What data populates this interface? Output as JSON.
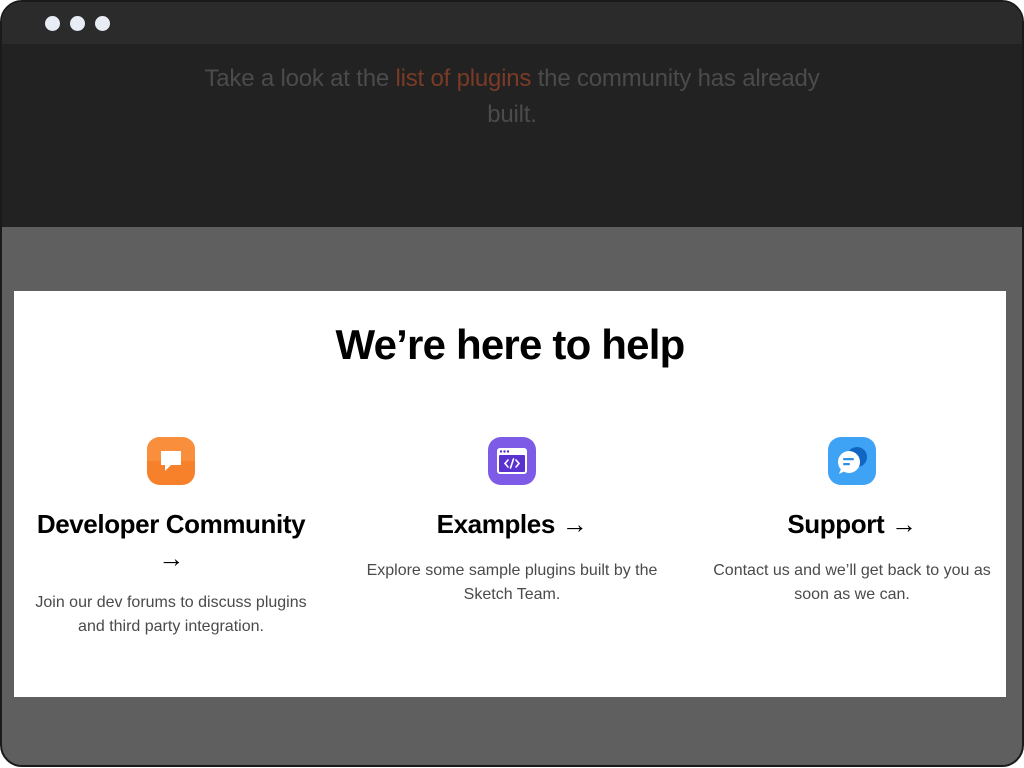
{
  "window": {
    "controls": [
      "close-dot",
      "minimize-dot",
      "maximize-dot"
    ]
  },
  "intro": {
    "prefix": "Take a look at the ",
    "link_text": "list of plugins",
    "suffix": " the community has already built."
  },
  "help": {
    "title": "We’re here to help",
    "columns": [
      {
        "icon": "chat-bubble-icon",
        "icon_color": "#f7812a",
        "title": "Developer Community →",
        "description": "Join our dev forums to discuss plugins and third party integration."
      },
      {
        "icon": "code-window-icon",
        "icon_color": "#7d5be6",
        "title": "Examples →",
        "description": "Explore some sample plugins built by the Sketch Team."
      },
      {
        "icon": "support-chat-icon",
        "icon_color": "#3ea2f5",
        "title": "Support →",
        "description": "Contact us and we’ll get back to you as soon as we can."
      }
    ]
  },
  "colors": {
    "titlebar": "#2b2b2b",
    "dark_band": "#222222",
    "overlay": "#5f5f5f",
    "card": "#ffffff",
    "link": "#7a3b26"
  }
}
